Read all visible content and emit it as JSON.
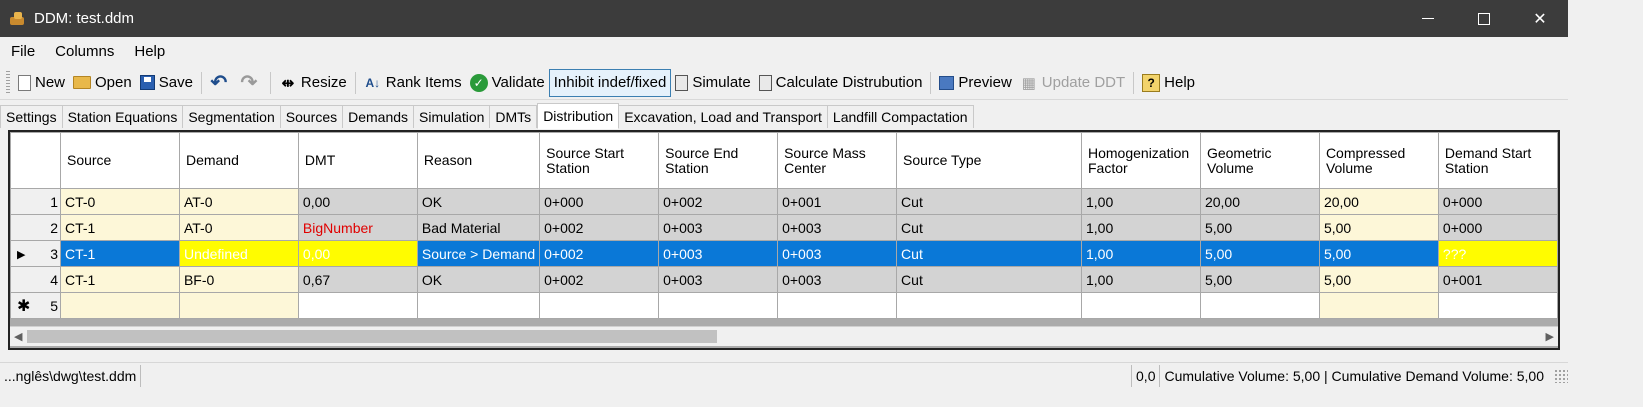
{
  "window": {
    "title": "DDM: test.ddm"
  },
  "menu": [
    "File",
    "Columns",
    "Help"
  ],
  "toolbar": {
    "new": "New",
    "open": "Open",
    "save": "Save",
    "resize": "Resize",
    "rank_items": "Rank Items",
    "validate": "Validate",
    "inhibit": "Inhibit indef/fixed",
    "simulate": "Simulate",
    "calculate": "Calculate Distrubution",
    "preview": "Preview",
    "update_ddt": "Update DDT",
    "help": "Help"
  },
  "tabs": [
    "Settings",
    "Station Equations",
    "Segmentation",
    "Sources",
    "Demands",
    "Simulation",
    "DMTs",
    "Distribution",
    "Excavation, Load and Transport",
    "Landfill Compactation"
  ],
  "active_tab": "Distribution",
  "grid": {
    "columns": [
      "Source",
      "Demand",
      "DMT",
      "Reason",
      "Source Start Station",
      "Source End Station",
      "Source Mass Center",
      "Source Type",
      "Homogenization Factor",
      "Geometric Volume",
      "Compressed Volume",
      "Demand Start Station"
    ],
    "rows": [
      {
        "num": "1",
        "cells": [
          "CT-0",
          "AT-0",
          "0,00",
          "OK",
          "0+000",
          "0+002",
          "0+001",
          "Cut",
          "1,00",
          "20,00",
          "20,00",
          "0+000"
        ]
      },
      {
        "num": "2",
        "cells": [
          "CT-1",
          "AT-0",
          "BigNumber",
          "Bad Material",
          "0+002",
          "0+003",
          "0+003",
          "Cut",
          "1,00",
          "5,00",
          "5,00",
          "0+000"
        ]
      },
      {
        "num": "3",
        "cells": [
          "CT-1",
          "Undefined",
          "0,00",
          "Source > Demand",
          "0+002",
          "0+003",
          "0+003",
          "Cut",
          "1,00",
          "5,00",
          "5,00",
          "???"
        ]
      },
      {
        "num": "4",
        "cells": [
          "CT-1",
          "BF-0",
          "0,67",
          "OK",
          "0+002",
          "0+003",
          "0+003",
          "Cut",
          "1,00",
          "5,00",
          "5,00",
          "0+001"
        ]
      }
    ],
    "new_row_num": "5"
  },
  "status": {
    "path": "...nglês\\dwg\\test.ddm",
    "coords": "0,0",
    "volumes": "Cumulative Volume: 5,00 | Cumulative Demand Volume: 5,00"
  },
  "icons": [
    "app-icon",
    "new-icon",
    "open-icon",
    "save-icon",
    "undo-icon",
    "redo-icon",
    "resize-icon",
    "sort-icon",
    "validate-icon",
    "simulate-icon",
    "calculator-icon",
    "preview-icon",
    "update-icon",
    "help-icon"
  ],
  "colors": {
    "selection": "#0a78d7",
    "error_text": "#e00000",
    "highlight": "#fffc00",
    "editable_cell": "#fdf7d8",
    "readonly_cell": "#d3d3d3"
  }
}
